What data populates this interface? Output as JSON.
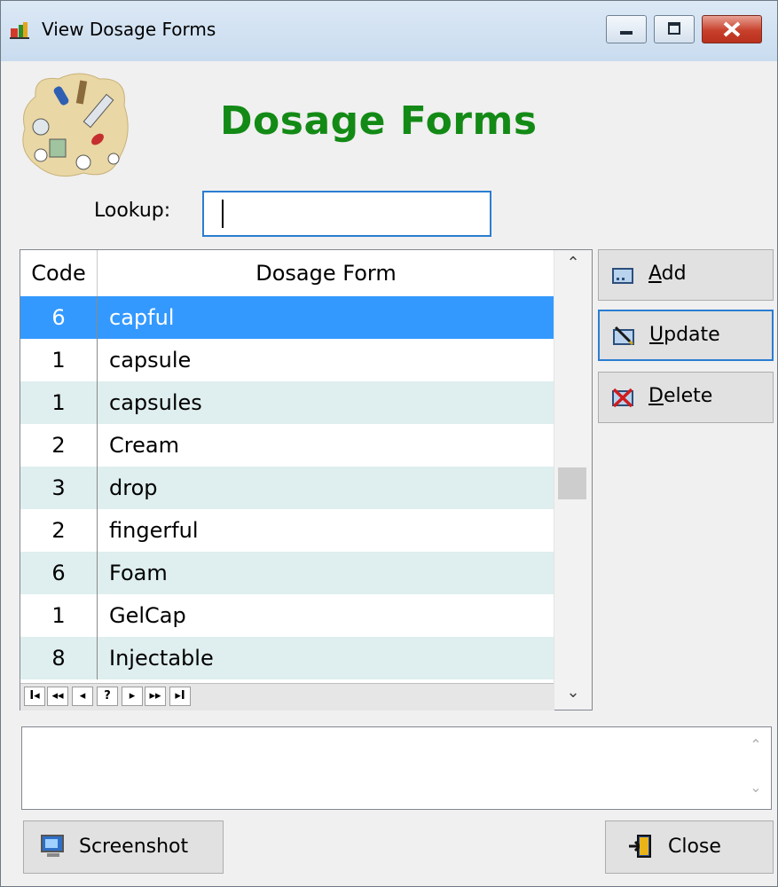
{
  "window": {
    "title": "View Dosage Forms",
    "minimize_label": "minimize",
    "maximize_label": "maximize",
    "close_label": "close"
  },
  "header": {
    "heading": "Dosage Forms",
    "logo_icon": "medicine-pills-syringe-icon"
  },
  "lookup": {
    "label": "Lookup:",
    "value": ""
  },
  "grid": {
    "columns": [
      "Code",
      "Dosage Form"
    ],
    "rows": [
      {
        "code": "6",
        "form": "capful",
        "selected": true
      },
      {
        "code": "1",
        "form": "capsule"
      },
      {
        "code": "1",
        "form": "capsules"
      },
      {
        "code": "2",
        "form": "Cream"
      },
      {
        "code": "3",
        "form": "drop"
      },
      {
        "code": "2",
        "form": "fingerful"
      },
      {
        "code": "6",
        "form": "Foam"
      },
      {
        "code": "1",
        "form": "GelCap"
      },
      {
        "code": "8",
        "form": "Injectable"
      }
    ],
    "navigator": [
      "I◂",
      "◂◂",
      "◂",
      "?",
      "▸",
      "▸▸",
      "▸I"
    ]
  },
  "buttons": {
    "add": {
      "label": "Add",
      "underline": "A",
      "rest": "dd"
    },
    "update": {
      "label": "Update",
      "underline": "U",
      "rest": "pdate"
    },
    "delete": {
      "label": "Delete",
      "underline": "D",
      "rest": "elete"
    },
    "screenshot": "Screenshot",
    "close": "Close"
  },
  "memo": {
    "text": ""
  },
  "colors": {
    "heading": "#138a16",
    "selection": "#3399ff",
    "alt_row": "#dfeeee",
    "focus": "#2a7dd1"
  }
}
